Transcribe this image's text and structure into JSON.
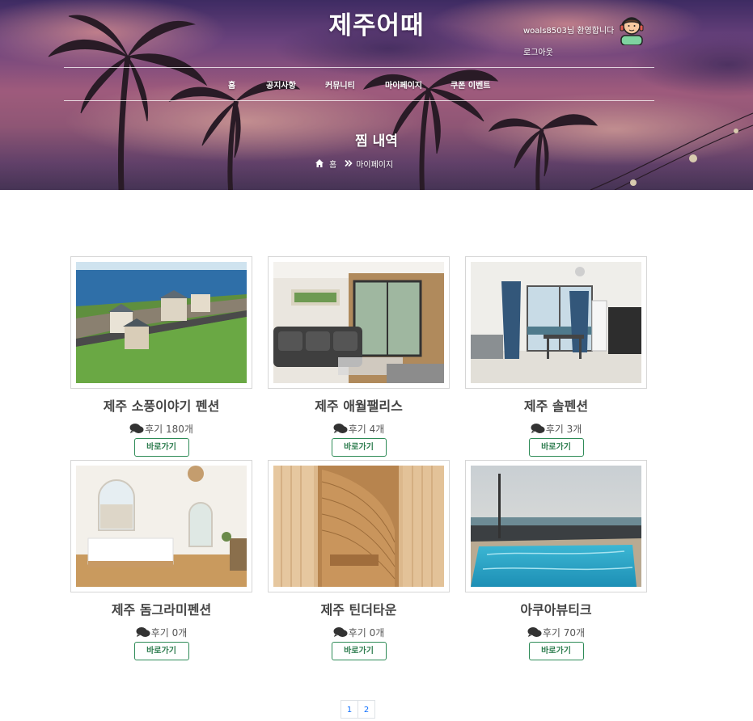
{
  "header": {
    "logo": "제주어때",
    "welcome": "woals8503님 환영합니다",
    "logout": "로그아웃",
    "nav": [
      {
        "label": "홈"
      },
      {
        "label": "공지사항"
      },
      {
        "label": "커뮤니티"
      },
      {
        "label": "마이페이지"
      },
      {
        "label": "쿠폰 이벤트"
      }
    ]
  },
  "hero": {
    "title": "찜 내역",
    "breadcrumb": {
      "home": "홈",
      "current": "마이페이지"
    }
  },
  "cards": [
    {
      "name": "제주 소풍이야기 펜션",
      "review": "후기 180개",
      "button": "바로가기",
      "image": "ocean-pension-photo"
    },
    {
      "name": "제주 애월팰리스",
      "review": "후기 4개",
      "button": "바로가기",
      "image": "living-room-sofa-photo"
    },
    {
      "name": "제주 솔펜션",
      "review": "후기 3개",
      "button": "바로가기",
      "image": "dining-room-photo"
    },
    {
      "name": "제주 돔그라미펜션",
      "review": "후기 0개",
      "button": "바로가기",
      "image": "dome-bedroom-photo"
    },
    {
      "name": "제주 틴더타운",
      "review": "후기 0개",
      "button": "바로가기",
      "image": "wooden-sauna-photo"
    },
    {
      "name": "아쿠아뷰티크",
      "review": "후기 70개",
      "button": "바로가기",
      "image": "seaside-pool-photo"
    }
  ],
  "pagination": {
    "pages": [
      "1",
      "2"
    ]
  },
  "colors": {
    "accent_green": "#2e8b57",
    "page_link": "#0d6efd"
  }
}
